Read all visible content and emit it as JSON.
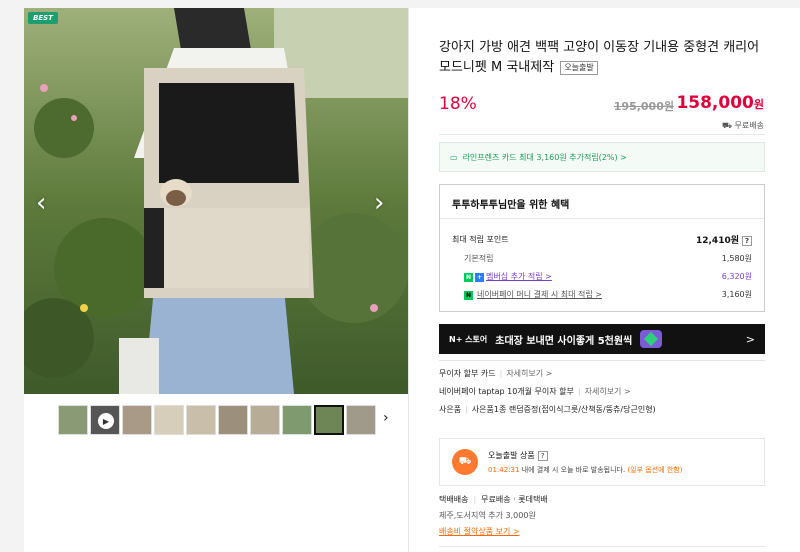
{
  "gallery": {
    "badge": "BEST",
    "thumb_count": 10,
    "active_thumb": 8
  },
  "product": {
    "title": "강아지 가방 애견 백팩 고양이 이동장 기내용 중형견 캐리어 모드니펫 M 국내제작",
    "tag": "오늘출발",
    "discount": "18%",
    "original_price": "195,000원",
    "price": "158,000",
    "price_unit": "원",
    "shipping": "무료배송"
  },
  "card_promo": "라인프렌즈 카드 최대 3,160원 추가적립(2%) >",
  "benefit": {
    "title": "투투하투투님만을 위한 혜택",
    "max_label": "최대 적립 포인트",
    "max_value": "12,410원",
    "rows": [
      {
        "label": "기본적립",
        "value": "1,580원"
      },
      {
        "label": "멤버십 추가 적립 >",
        "value": "6,320원"
      },
      {
        "label": "네이버페이 머니 결제 시 최대 적립 >",
        "value": "3,160원"
      }
    ]
  },
  "banner": {
    "logo": "N+ 스토어",
    "text": "초대장 보내면 사이좋게 5천원씩",
    "chevron": ">"
  },
  "payments": {
    "installment_label": "무이자 할부 카드",
    "installment_more": "자세히보기 >",
    "taptap_label": "네이버페이 taptap 10개월 무이자 할부",
    "taptap_more": "자세히보기 >",
    "gift_label": "사은품",
    "gift_text": "사은품1종 랜덤증정(접이식그릇/산책동/뚱츄/당근인형)"
  },
  "today_ship": {
    "title": "오늘출발 상품",
    "time": "01:42:31",
    "text": "내에 결제 시 오늘 바로 발송됩니다.",
    "note": "(일부 옵션에 한함)"
  },
  "delivery": {
    "type": "택배배송",
    "info": "무료배송 · 롯데택배",
    "extra": "제주,도서지역 추가 3,000원",
    "link": "배송비 절약상품 보기 >"
  },
  "colors": {
    "accent_red": "#e0003c",
    "naver_green": "#03c75a",
    "orange": "#ff6a00"
  }
}
